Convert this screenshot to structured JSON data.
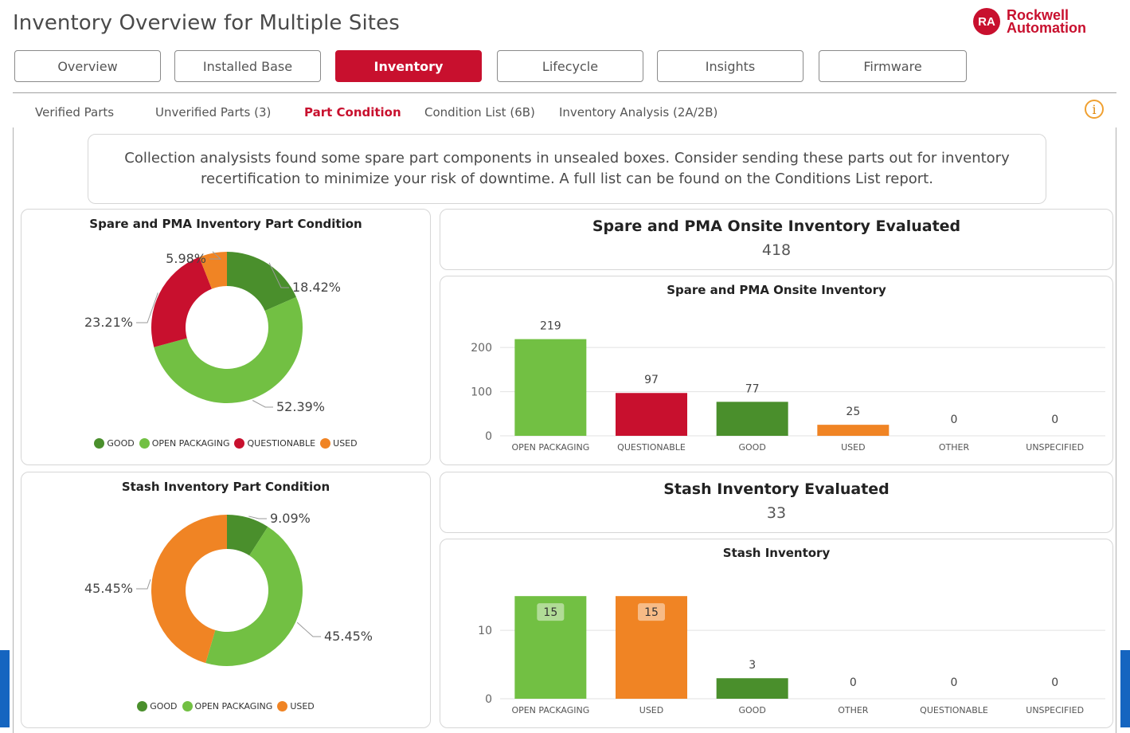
{
  "header": {
    "title": "Inventory Overview for Multiple Sites",
    "logo_mark": "RA",
    "logo_line1": "Rockwell",
    "logo_line2": "Automation"
  },
  "tabs": [
    {
      "label": "Overview"
    },
    {
      "label": "Installed Base"
    },
    {
      "label": "Inventory"
    },
    {
      "label": "Lifecycle"
    },
    {
      "label": "Insights"
    },
    {
      "label": "Firmware"
    }
  ],
  "active_tab": "Inventory",
  "subtabs": [
    {
      "label": "Verified Parts"
    },
    {
      "label": "Unverified Parts (3)"
    },
    {
      "label": "Part Condition"
    },
    {
      "label": "Condition List (6B)"
    },
    {
      "label": "Inventory Analysis (2A/2B)"
    }
  ],
  "active_subtab": "Part Condition",
  "info_icon": "i",
  "notice": "Collection analysists found some spare part components in unsealed boxes.  Consider sending these parts out for inventory recertification to minimize your risk of downtime.  A full list can be found on the Conditions List report.",
  "colors": {
    "good": "#4a8f2c",
    "open_packaging": "#72c043",
    "questionable": "#c8102e",
    "used": "#f08424",
    "accent": "#c8102e"
  },
  "kpis": {
    "spare": {
      "title": "Spare and PMA Onsite Inventory Evaluated",
      "value": "418"
    },
    "stash": {
      "title": "Stash Inventory Evaluated",
      "value": "33"
    }
  },
  "chart_data": [
    {
      "type": "pie",
      "title": "Spare and PMA Inventory Part Condition",
      "donut": true,
      "slices": [
        {
          "label": "GOOD",
          "value": 18.42,
          "display": "18.42%",
          "color": "#4a8f2c"
        },
        {
          "label": "OPEN PACKAGING",
          "value": 52.39,
          "display": "52.39%",
          "color": "#72c043"
        },
        {
          "label": "QUESTIONABLE",
          "value": 23.21,
          "display": "23.21%",
          "color": "#c8102e"
        },
        {
          "label": "USED",
          "value": 5.98,
          "display": "5.98%",
          "color": "#f08424"
        }
      ],
      "legend": [
        "GOOD",
        "OPEN PACKAGING",
        "QUESTIONABLE",
        "USED"
      ],
      "legend_position": "bottom"
    },
    {
      "type": "bar",
      "title": "Spare and PMA Onsite Inventory",
      "categories": [
        "OPEN PACKAGING",
        "QUESTIONABLE",
        "GOOD",
        "USED",
        "OTHER",
        "UNSPECIFIED"
      ],
      "values": [
        219,
        97,
        77,
        25,
        0,
        0
      ],
      "colors": [
        "#72c043",
        "#c8102e",
        "#4a8f2c",
        "#f08424",
        "#72c043",
        "#72c043"
      ],
      "yticks": [
        0,
        100,
        200
      ],
      "ylim": [
        0,
        240
      ],
      "grid": true
    },
    {
      "type": "pie",
      "title": "Stash Inventory Part Condition",
      "donut": true,
      "slices": [
        {
          "label": "GOOD",
          "value": 9.09,
          "display": "9.09%",
          "color": "#4a8f2c"
        },
        {
          "label": "OPEN PACKAGING",
          "value": 45.45,
          "display": "45.45%",
          "color": "#72c043"
        },
        {
          "label": "USED",
          "value": 45.45,
          "display": "45.45%",
          "color": "#f08424"
        }
      ],
      "legend": [
        "GOOD",
        "OPEN PACKAGING",
        "USED"
      ],
      "legend_position": "bottom"
    },
    {
      "type": "bar",
      "title": "Stash Inventory",
      "categories": [
        "OPEN PACKAGING",
        "USED",
        "GOOD",
        "OTHER",
        "QUESTIONABLE",
        "UNSPECIFIED"
      ],
      "values": [
        15,
        15,
        3,
        0,
        0,
        0
      ],
      "colors": [
        "#72c043",
        "#f08424",
        "#4a8f2c",
        "#72c043",
        "#72c043",
        "#72c043"
      ],
      "yticks": [
        0,
        10
      ],
      "ylim": [
        0,
        17
      ],
      "grid": true,
      "inner_labels": true
    }
  ]
}
